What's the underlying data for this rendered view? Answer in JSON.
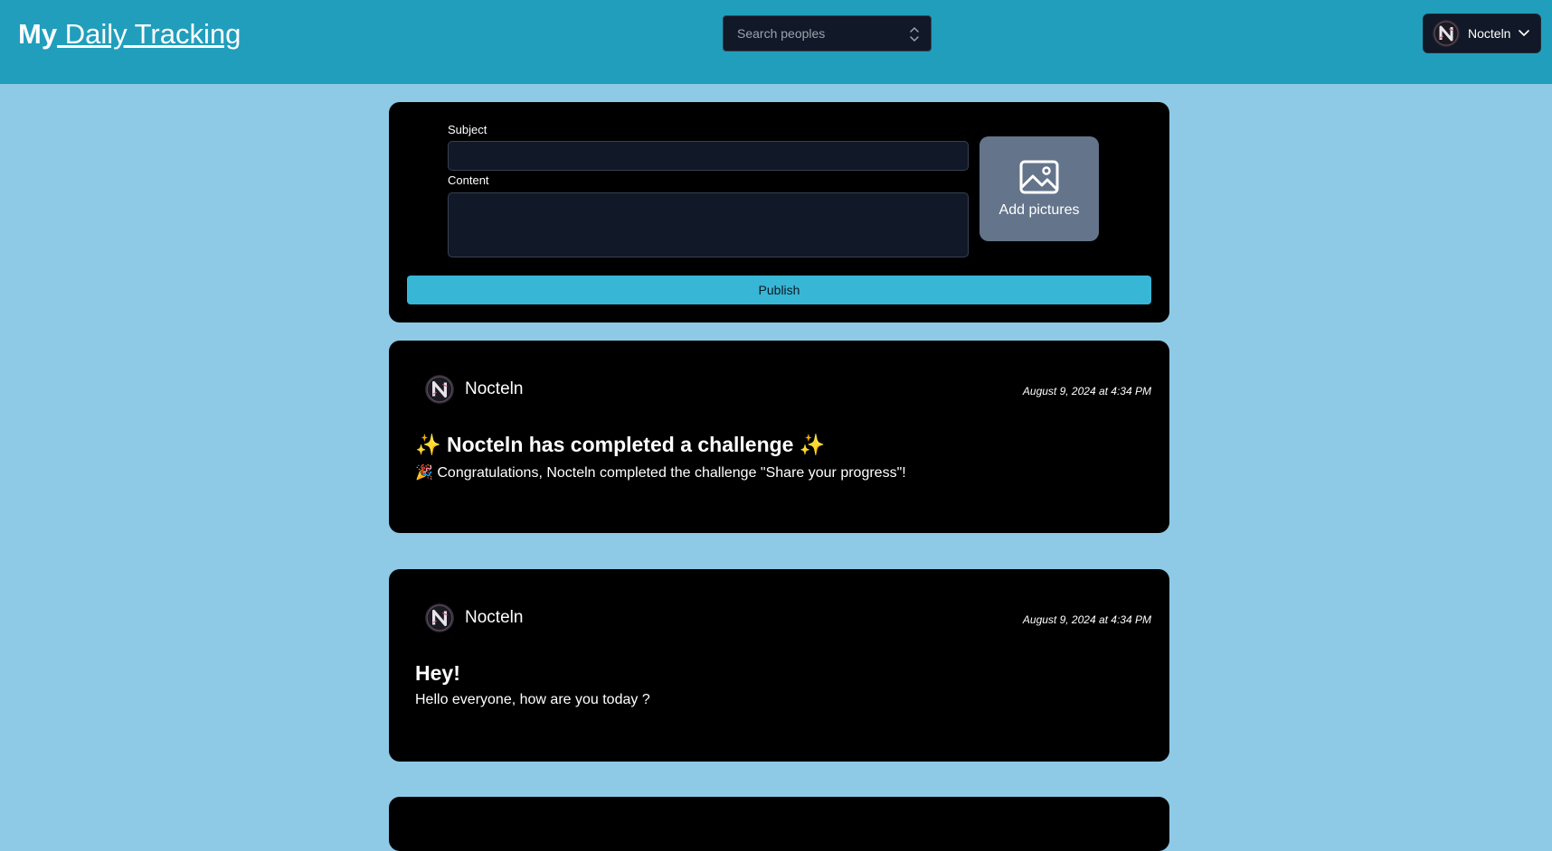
{
  "header": {
    "brand_strong": "My",
    "brand_link": " Daily Tracking",
    "search": {
      "placeholder": "Search peoples",
      "value": ""
    },
    "user_menu": {
      "name": "Nocteln"
    }
  },
  "composer": {
    "subject_label": "Subject",
    "subject_value": "",
    "content_label": "Content",
    "content_value": "",
    "add_pictures_label": "Add pictures",
    "publish_label": "Publish"
  },
  "posts": [
    {
      "author": "Nocteln",
      "timestamp": "August 9, 2024 at 4:34 PM",
      "title": "✨ Nocteln has completed a challenge ✨",
      "body": "🎉 Congratulations, Nocteln completed the challenge \"Share your progress\"!"
    },
    {
      "author": "Nocteln",
      "timestamp": "August 9, 2024 at 4:34 PM",
      "title": "Hey!",
      "body": "Hello everyone, how are you today ?"
    }
  ],
  "colors": {
    "header_bg": "#219ebc",
    "page_bg": "#8ecae6",
    "card_bg": "#000000",
    "publish_bg": "#38b6d6",
    "add_pictures_bg": "#64748b"
  },
  "icons": [
    "updown-icon",
    "chevron-down-icon",
    "image-icon",
    "avatar"
  ]
}
